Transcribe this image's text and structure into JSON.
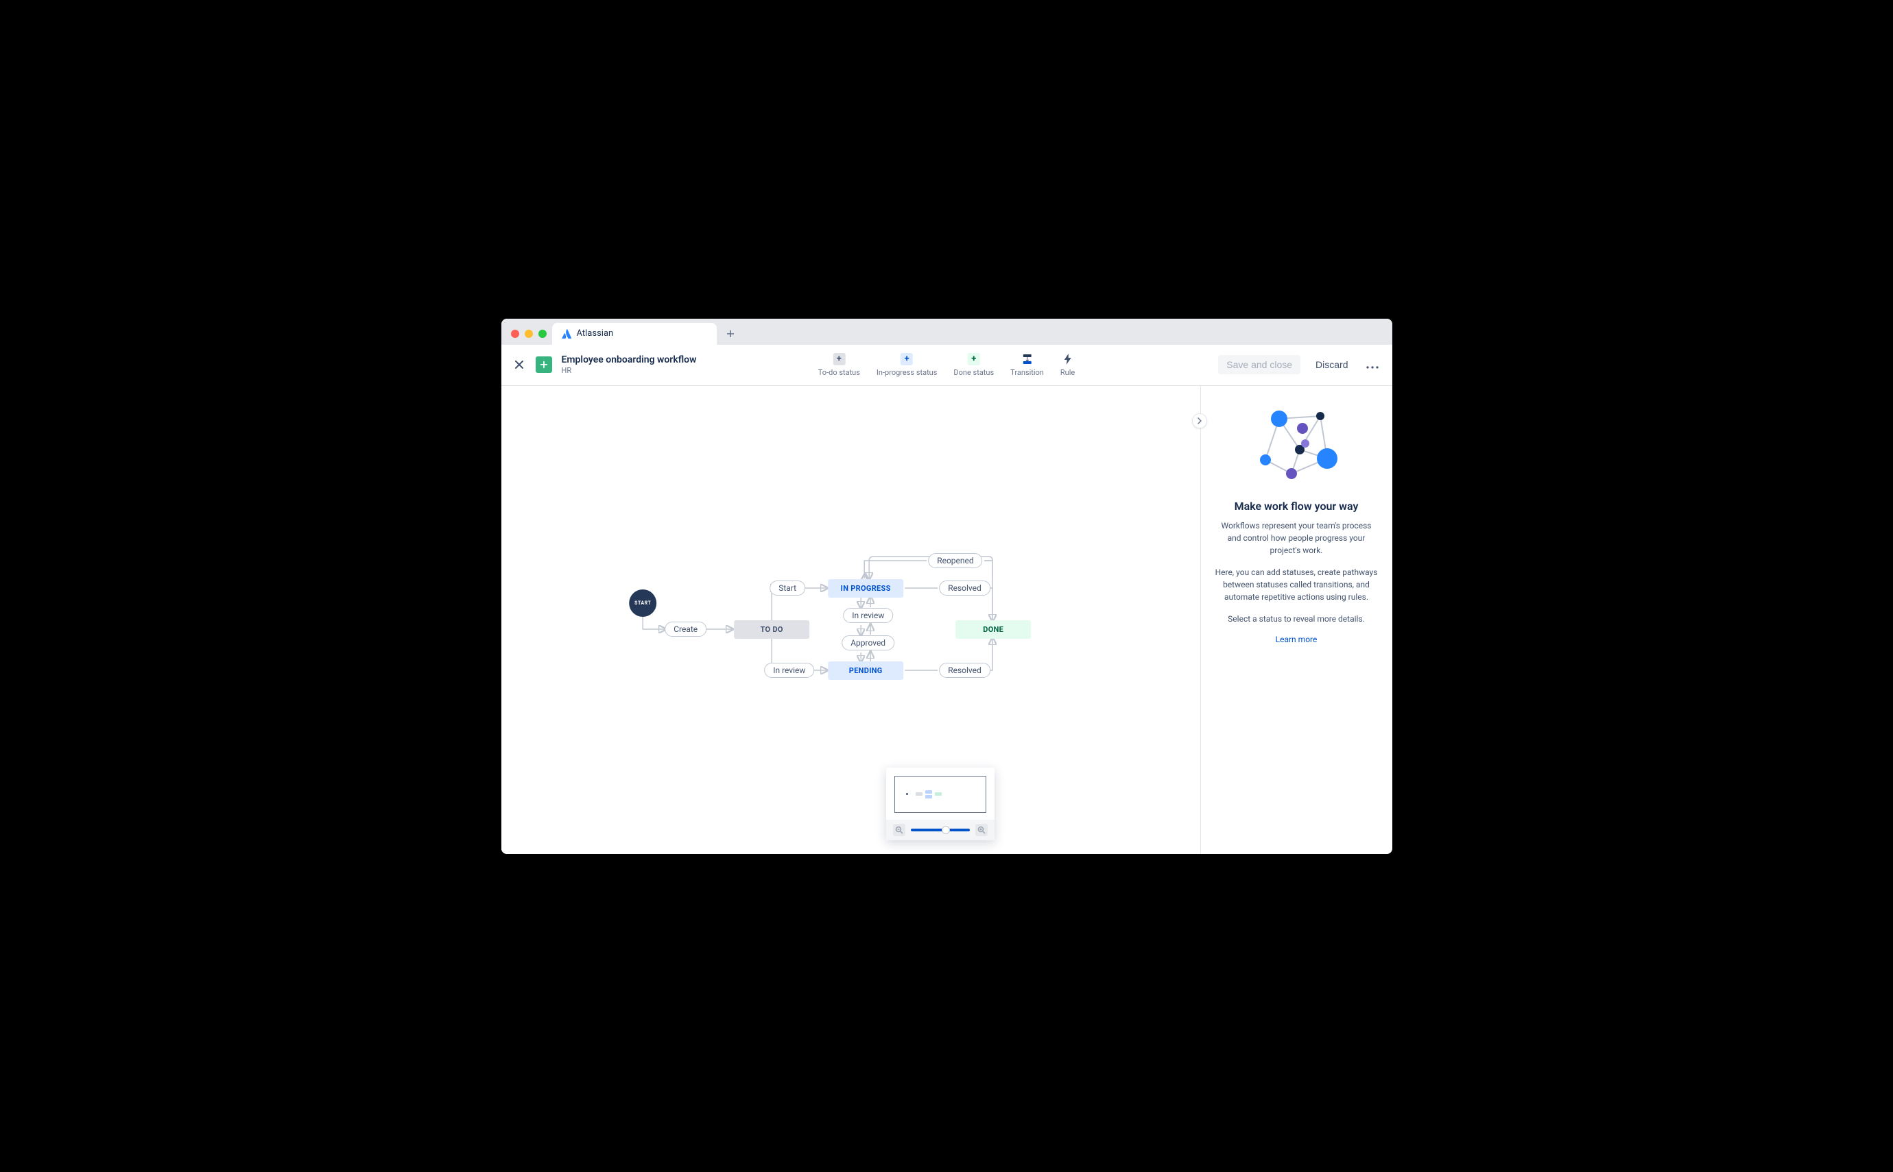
{
  "tab": {
    "title": "Atlassian"
  },
  "header": {
    "title": "Employee onboarding workflow",
    "project": "HR",
    "save": "Save and close",
    "discard": "Discard"
  },
  "toolbar": {
    "todo": "To-do status",
    "inprogress": "In-progress status",
    "done": "Done status",
    "transition": "Transition",
    "rule": "Rule"
  },
  "diagram": {
    "start": "START",
    "statuses": {
      "todo": "TO DO",
      "inprogress": "IN PROGRESS",
      "pending": "PENDING",
      "done": "DONE"
    },
    "transitions": {
      "create": "Create",
      "start": "Start",
      "inreview1": "In review",
      "inreview2": "In review",
      "approved": "Approved",
      "reopened": "Reopened",
      "resolved1": "Resolved",
      "resolved2": "Resolved"
    }
  },
  "panel": {
    "heading": "Make work flow your way",
    "p1": "Workflows represent your team's process and control how people progress your project's work.",
    "p2": "Here, you can add statuses, create pathways between statuses called transitions, and automate repetitive actions using rules.",
    "p3": "Select a status to reveal more details.",
    "learn": "Learn more"
  }
}
